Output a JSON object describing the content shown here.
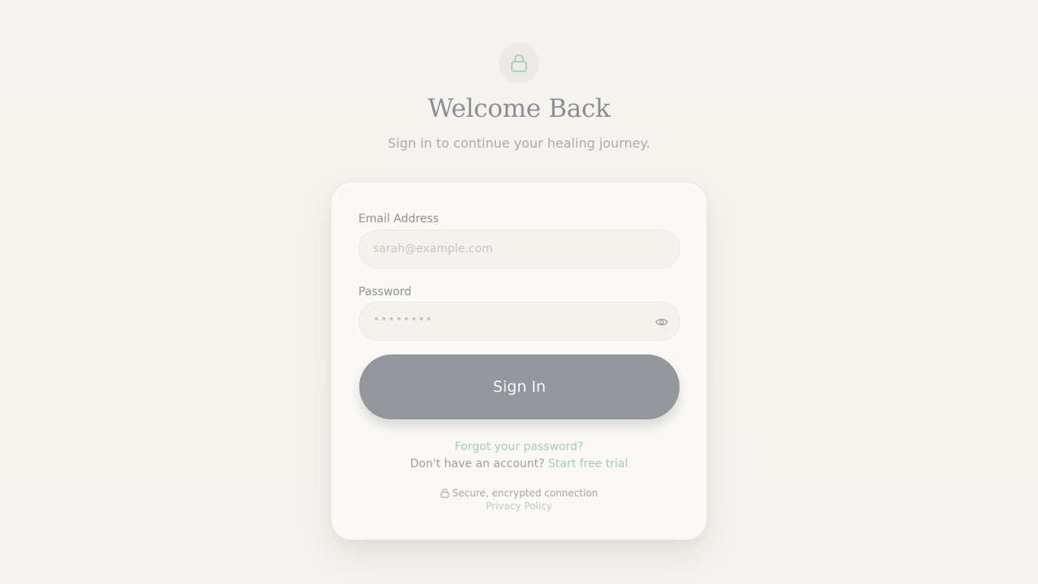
{
  "header": {
    "icon": "lock-icon",
    "title": "Welcome Back",
    "subtitle": "Sign in to continue your healing journey."
  },
  "form": {
    "email": {
      "label": "Email Address",
      "placeholder": "sarah@example.com",
      "value": ""
    },
    "password": {
      "label": "Password",
      "masked_value": "••••••••",
      "toggle_icon": "eye-icon"
    },
    "submit_label": "Sign In"
  },
  "links": {
    "forgot_password": "Forgot your password?",
    "no_account_text": "Don't have an account?",
    "start_trial": "Start free trial",
    "secure_text": "Secure, encrypted connection",
    "secure_icon": "lock-icon",
    "privacy_policy": "Privacy Policy"
  },
  "colors": {
    "accent": "#a3cdb6",
    "button": "#93979c",
    "background": "#f5f3ef"
  }
}
